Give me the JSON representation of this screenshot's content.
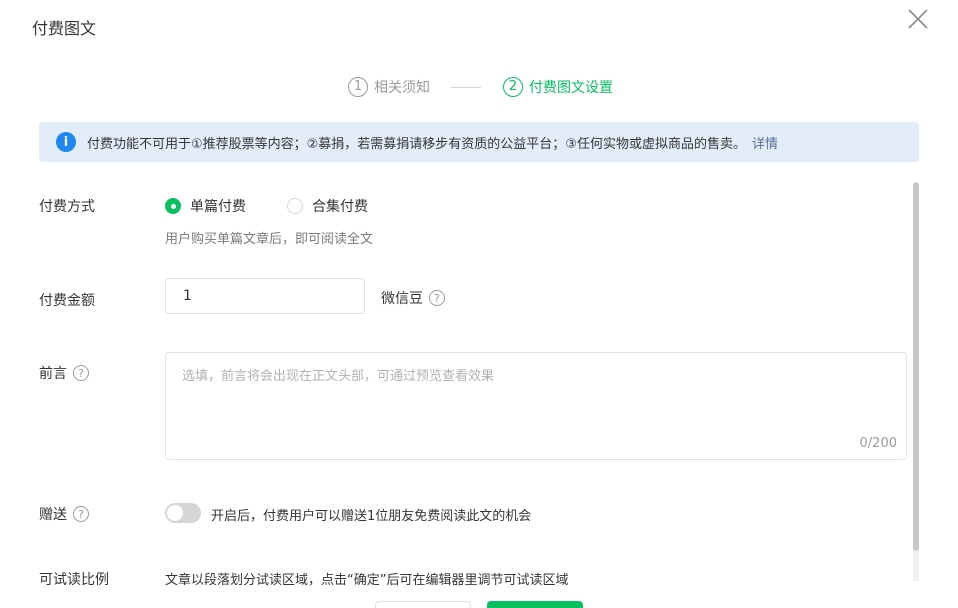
{
  "dialog": {
    "title": "付费图文"
  },
  "steps": [
    {
      "num": "1",
      "label": "相关须知"
    },
    {
      "num": "2",
      "label": "付费图文设置"
    }
  ],
  "notice": {
    "icon": "i",
    "text": "付费功能不可用于①推荐股票等内容；②募捐，若需募捐请移步有资质的公益平台；③任何实物或虚拟商品的售卖。",
    "link": "详情"
  },
  "form": {
    "payment_method": {
      "label": "付费方式",
      "options": [
        "单篇付费",
        "合集付费"
      ],
      "selected": "单篇付费",
      "hint": "用户购买单篇文章后，即可阅读全文"
    },
    "amount": {
      "label": "付费金额",
      "value": "1",
      "unit": "微信豆"
    },
    "preface": {
      "label": "前言",
      "placeholder": "选填，前言将会出现在正文头部，可通过预览查看效果",
      "counter": "0/200"
    },
    "gift": {
      "label": "赠送",
      "enabled": false,
      "text": "开启后，付费用户可以赠送1位朋友免费阅读此文的机会"
    },
    "trial": {
      "label": "可试读比例",
      "text": "文章以段落划分试读区域，点击“确定”后可在编辑器里调节可试读区域"
    }
  },
  "colors": {
    "accent": "#07c160",
    "info_blue": "#1e88f5",
    "notice_bg": "#e3edf9",
    "link": "#576b95"
  }
}
